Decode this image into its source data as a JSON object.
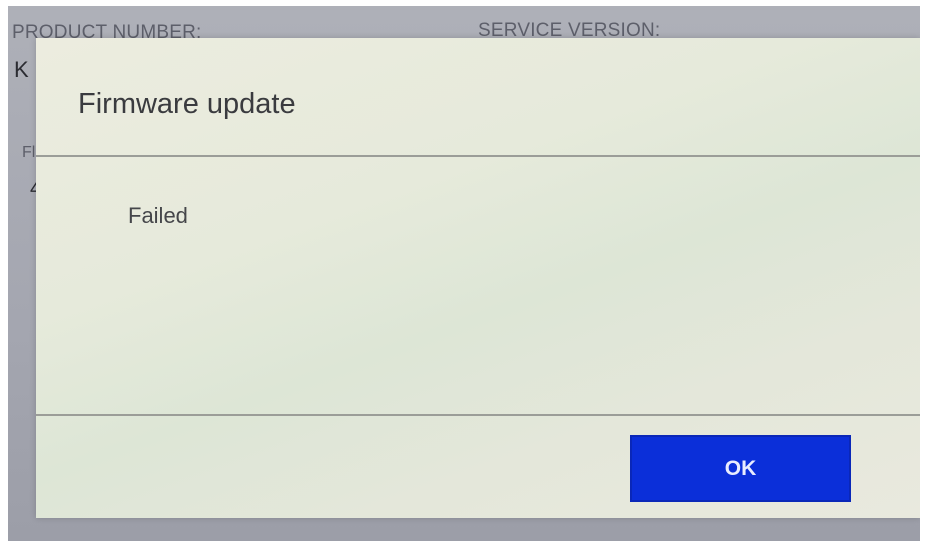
{
  "background": {
    "product_number_label": "PRODUCT NUMBER:",
    "service_version_label": "SERVICE VERSION:",
    "product_number_value_partial": "K",
    "second_label_partial": "Fl",
    "second_value_partial": "4"
  },
  "dialog": {
    "title": "Firmware update",
    "message": "Failed",
    "ok_label": "OK"
  },
  "colors": {
    "ok_button": "#0b2fd9",
    "dialog_bg": "#e6eadb",
    "screen_bg": "#a8aab3"
  }
}
